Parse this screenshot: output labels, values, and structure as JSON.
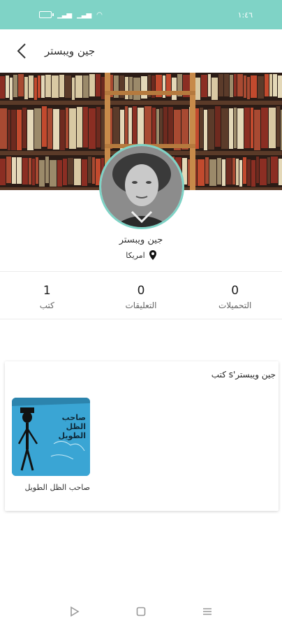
{
  "status_bar": {
    "time": "١:٤٦"
  },
  "header": {
    "title": "جين ويبستر"
  },
  "profile": {
    "name": "جين ويبستر",
    "location": "امريكا"
  },
  "stats": [
    {
      "value": "0",
      "label": "التحميلات"
    },
    {
      "value": "0",
      "label": "التعليقات"
    },
    {
      "value": "1",
      "label": "كتب"
    }
  ],
  "books_section": {
    "title": "جين ويبستر's كتب",
    "books": [
      {
        "title": "صاحب الظل الطويل",
        "cover_text": "صاحب الظل الطويل"
      }
    ]
  },
  "colors": {
    "accent": "#7fd3c6",
    "book_cover": "#3aa5d4"
  },
  "icons": {
    "back": "chevron-left-icon",
    "location": "location-pin-icon",
    "nav_back": "triangle-back-icon",
    "nav_home": "square-home-icon",
    "nav_menu": "menu-lines-icon"
  }
}
